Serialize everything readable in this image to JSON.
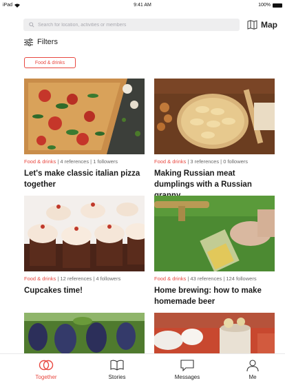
{
  "status_bar": {
    "device": "iPad",
    "time": "9:41 AM",
    "battery": "100%"
  },
  "search": {
    "placeholder": "Search for location, activities or members"
  },
  "map": {
    "label": "Map"
  },
  "filters": {
    "label": "Filters"
  },
  "active_filter": {
    "label": "Food & drinks"
  },
  "colors": {
    "accent": "#e8473f",
    "text": "#222222",
    "muted": "#666666"
  },
  "cards": [
    {
      "category": "Food & drinks",
      "stats": " | 4 references | 1 followers",
      "title": "Let's make classic italian pizza together"
    },
    {
      "category": "Food & drinks",
      "stats": " | 3 references | 0 followers",
      "title": "Making Russian meat dumplings with a Russian granny"
    },
    {
      "category": "Food & drinks",
      "stats": " | 12 references | 4 followers",
      "title": "Cupcakes time!"
    },
    {
      "category": "Food & drinks",
      "stats": " | 43 references | 124 followers",
      "title": "Home brewing: how to make homemade beer"
    },
    {
      "category": "",
      "stats": "",
      "title": ""
    },
    {
      "category": "",
      "stats": "",
      "title": ""
    }
  ],
  "tabs": [
    {
      "label": "Together",
      "icon": "rings-icon",
      "active": true
    },
    {
      "label": "Stories",
      "icon": "book-icon",
      "active": false
    },
    {
      "label": "Messages",
      "icon": "chat-icon",
      "active": false
    },
    {
      "label": "Me",
      "icon": "person-icon",
      "active": false
    }
  ]
}
